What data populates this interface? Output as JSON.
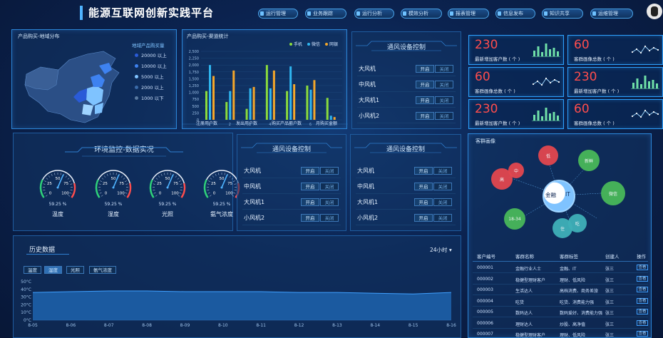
{
  "header": {
    "title": "能源互联网创新实践平台",
    "nav": [
      "运行管理",
      "业务跟踪",
      "运行分析",
      "模效分析",
      "报表管理",
      "信息发布",
      "知识共享",
      "运维管理"
    ]
  },
  "map_panel": {
    "title": "产品购买-地域分布",
    "legend_title": "地域产品购买量",
    "legend": [
      {
        "label": "20000 以上",
        "color": "#2a5bd8"
      },
      {
        "label": "10000 以上",
        "color": "#3e82f0"
      },
      {
        "label": "5000 以上",
        "color": "#7fc3ff"
      },
      {
        "label": "2000 以上",
        "color": "#3a6aa8"
      },
      {
        "label": "1000 以下",
        "color": "#5a7aa0"
      }
    ]
  },
  "bar_panel": {
    "title": "产品购买-渠道统计",
    "footer_labels": [
      "注册用户数",
      "发出用户数",
      "购买产品用户数",
      "月购买金额"
    ],
    "chart_data": {
      "type": "bar",
      "categories": [
        "1",
        "2",
        "3",
        "4",
        "5",
        "6",
        "7"
      ],
      "series": [
        {
          "name": "手机",
          "color": "#8bdc3c",
          "values": [
            1050,
            650,
            400,
            2000,
            1050,
            1250,
            800
          ]
        },
        {
          "name": "微信",
          "color": "#2fb6f0",
          "values": [
            2000,
            1050,
            1150,
            1150,
            1950,
            1100,
            150
          ]
        },
        {
          "name": "网银",
          "color": "#f4a62a",
          "values": [
            1600,
            1800,
            1200,
            1800,
            1300,
            1450,
            100
          ]
        }
      ],
      "yticks": [
        "0",
        "250",
        "500",
        "750",
        "1,000",
        "1,250",
        "1,500",
        "1,750",
        "2,000",
        "2,250",
        "2,500"
      ],
      "ylim": [
        0,
        2500
      ]
    }
  },
  "vent_top": {
    "title": "通风设备控制",
    "rows": [
      "大风机",
      "中风机",
      "大风机1",
      "小风机2"
    ],
    "on_label": "开启",
    "off_label": "关闭"
  },
  "vent_mid1": {
    "title": "通风设备控制",
    "rows": [
      "大风机",
      "中风机",
      "大风机1",
      "小风机2"
    ],
    "on_label": "开启",
    "off_label": "关闭"
  },
  "vent_mid2": {
    "title": "通风设备控制",
    "rows": [
      "大风机",
      "中风机",
      "大风机1",
      "小风机2"
    ],
    "on_label": "开启",
    "off_label": "关闭"
  },
  "stats": [
    {
      "value": "230",
      "label": "最新增加客户数 ( 个 )"
    },
    {
      "value": "60",
      "label": "客群画像总数 ( 个 )"
    },
    {
      "value": "60",
      "label": "客群画像总数 ( 个 )"
    },
    {
      "value": "230",
      "label": "最新增加客户数 ( 个 )"
    },
    {
      "value": "230",
      "label": "最新增加客户数 ( 个 )"
    },
    {
      "value": "60",
      "label": "客群画像总数 ( 个 )"
    }
  ],
  "env_panel": {
    "title": "环境监控-数据实况",
    "gauges": [
      {
        "label": "温度",
        "value": "59.25 %",
        "level": 0.5925
      },
      {
        "label": "湿度",
        "value": "59.25 %",
        "level": 0.5925
      },
      {
        "label": "光照",
        "value": "59.25 %",
        "level": 0.5925
      },
      {
        "label": "氨气浓度",
        "value": "59.25 %",
        "level": 0.5925
      }
    ],
    "gauge_ticks": [
      "0",
      "25",
      "50",
      "75",
      "100"
    ]
  },
  "customer_panel": {
    "title": "客群画像",
    "center_left": "金融",
    "center_right": "IT",
    "bubbles": [
      "高",
      "中",
      "低",
      "新鲜",
      "微信",
      "18-34",
      "住",
      "吃"
    ],
    "table_headers": [
      "客户编号",
      "客群名称",
      "客群标签",
      "创建人",
      "操作"
    ],
    "rows": [
      [
        "000001",
        "金融行业人士",
        "金融、IT",
        "张三",
        "查看"
      ],
      [
        "000002",
        "稳健型理财客户",
        "理财、低风险",
        "张三",
        "查看"
      ],
      [
        "000003",
        "生活达人",
        "高档消费、商务差旅",
        "张三",
        "查看"
      ],
      [
        "000004",
        "吃货",
        "吃货、消费能力强",
        "张三",
        "查看"
      ],
      [
        "000005",
        "数码达人",
        "数码爱好、消费能力强",
        "张三",
        "查看"
      ],
      [
        "000006",
        "理财达人",
        "炒股、高净值",
        "张三",
        "查看"
      ],
      [
        "000007",
        "稳健型理财客户",
        "理财、低风险",
        "张三",
        "查看"
      ]
    ]
  },
  "history_panel": {
    "title": "历史数据",
    "range": "24小时",
    "tabs": [
      "温度",
      "湿度",
      "光照",
      "氨气浓度"
    ],
    "active_tab": 1,
    "chart_data": {
      "type": "area",
      "x": [
        "8-05",
        "8-06",
        "8-07",
        "8-08",
        "8-09",
        "8-10",
        "8-11",
        "8-12",
        "8-13",
        "8-14",
        "8-15",
        "8-16"
      ],
      "yticks": [
        "0°C",
        "10°C",
        "20°C",
        "30°C",
        "40°C",
        "50°C"
      ],
      "ylim": [
        0,
        50
      ],
      "values": [
        36,
        37,
        38,
        38,
        37,
        37,
        37,
        36,
        36,
        35,
        34,
        36
      ]
    }
  }
}
